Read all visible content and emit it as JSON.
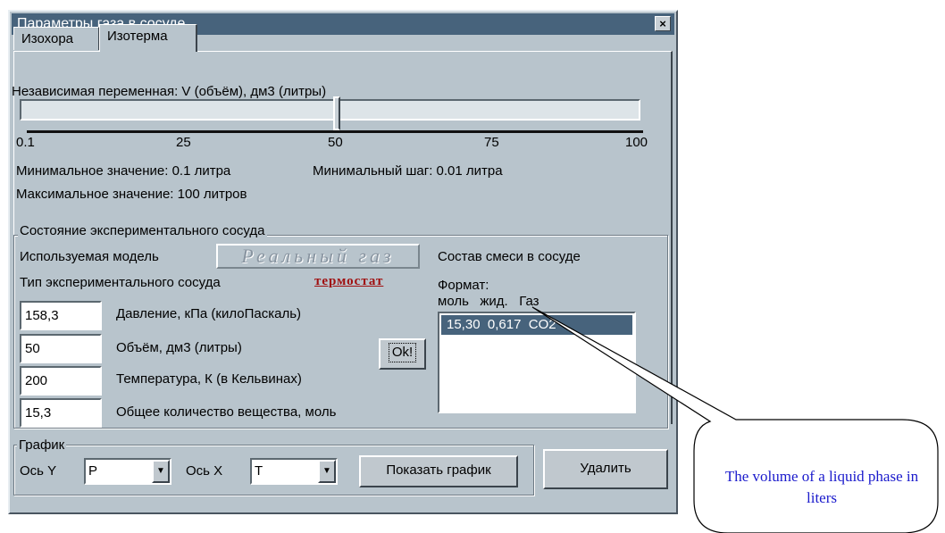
{
  "window": {
    "title": "Параметры газа в сосуде",
    "close": "×"
  },
  "tabs": [
    {
      "label": "Изохора",
      "active": false
    },
    {
      "label": "Изотерма",
      "active": true
    }
  ],
  "slider": {
    "label": "Независимая переменная: V (объём), дм3 (литры)",
    "value": 50,
    "ticks": [
      "0.1",
      "25",
      "50",
      "75",
      "100"
    ],
    "min_text": "Минимальное значение: 0.1 литра",
    "step_text": "Минимальный шаг: 0.01 литра",
    "max_text": "Максимальное значение: 100 литров"
  },
  "state": {
    "group_title": "Состояние экспериментального сосуда",
    "model_label": "Используемая модель",
    "model_button": "Реальный газ",
    "vessel_label": "Тип экспериментального сосуда",
    "vessel_value": "термостат",
    "fields": [
      {
        "value": "158,3",
        "label": "Давление, кПа (килоПаскаль)"
      },
      {
        "value": "50",
        "label": "Объём, дм3 (литры)"
      },
      {
        "value": "200",
        "label": "Температура, К (в Кельвинах)"
      },
      {
        "value": "15,3",
        "label": "Общее количество вещества, моль"
      }
    ],
    "ok_button": "Ok!",
    "mix_title": "Состав смеси в сосуде",
    "format_label": "Формат:",
    "format_columns": "моль   жид.   Газ",
    "mix_items": [
      "15,30  0,617  CO2"
    ]
  },
  "graph": {
    "group_title": "График",
    "axis_y_label": "Ось Y",
    "axis_y_value": "P",
    "axis_x_label": "Ось X",
    "axis_x_value": "T",
    "show_button": "Показать график",
    "delete_button": "Удалить"
  },
  "callout": {
    "text": "The volume of a liquid phase in liters"
  }
}
